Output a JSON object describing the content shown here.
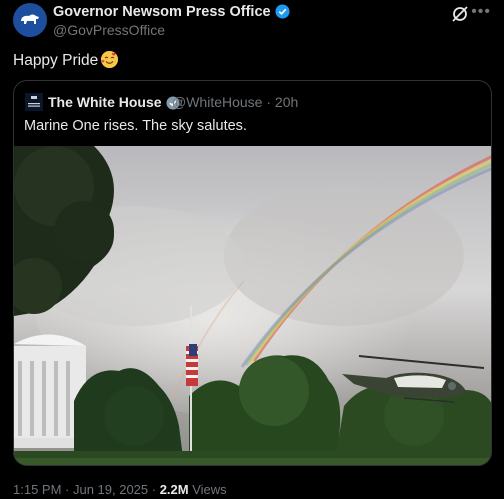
{
  "author": {
    "name": "Governor Newsom Press Office",
    "handle": "@GovPressOffice"
  },
  "tweet": {
    "text": "Happy Pride",
    "emoji_icon": "smiling-face-with-hearts-emoji"
  },
  "quote": {
    "name": "The White House",
    "handle_time": "@WhiteHouse · 20h",
    "text": "Marine One rises. The sky salutes.",
    "avatar_text": "WHITE HOUSE"
  },
  "meta": {
    "time_date": "1:15 PM · Jun 19, 2025 · ",
    "views_count": "2.2M",
    "views_label": " Views"
  },
  "colors": {
    "verified_blue": "#1d9bf0",
    "verified_gray": "#829aab",
    "avatar_blue": "#1d4f9e"
  }
}
